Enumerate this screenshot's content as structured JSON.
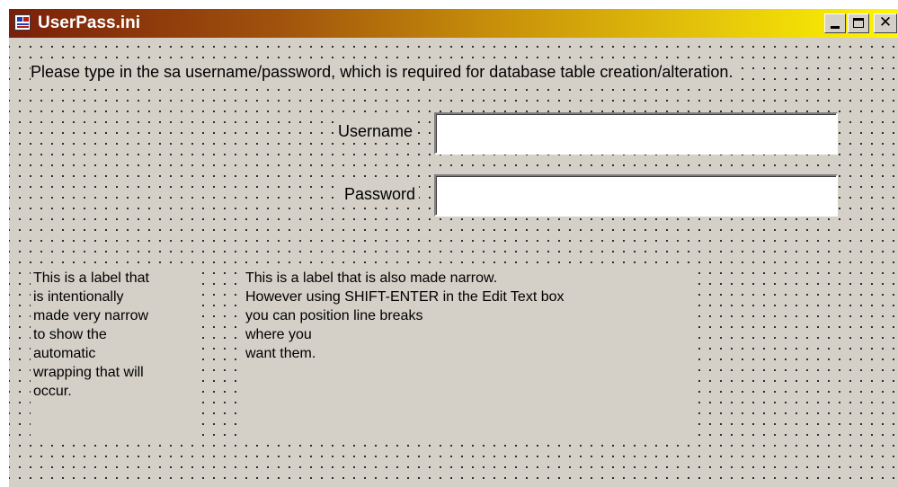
{
  "window": {
    "title": "UserPass.ini",
    "icon": "ini-file-icon",
    "controls": {
      "minimize": "minimize-icon",
      "maximize": "maximize-icon",
      "close_label": "✕"
    },
    "titlebar_gradient": [
      "#7a1f0a",
      "#fff700"
    ],
    "face_color": "#d4d0c8"
  },
  "form": {
    "instruction": "Please type in the sa username/password, which is required for database table creation/alteration.",
    "username_label": "Username",
    "username_value": "",
    "password_label": "Password",
    "password_value": ""
  },
  "labels": {
    "narrow_lines": [
      "This is a label that",
      "is intentionally",
      "made very narrow",
      "to show the",
      "automatic",
      "wrapping that will",
      "occur."
    ],
    "explicit_lines": [
      "This is a label that is also made narrow.",
      "However using SHIFT-ENTER in the Edit Text box",
      "you can position line breaks",
      "where you",
      "want them."
    ]
  }
}
